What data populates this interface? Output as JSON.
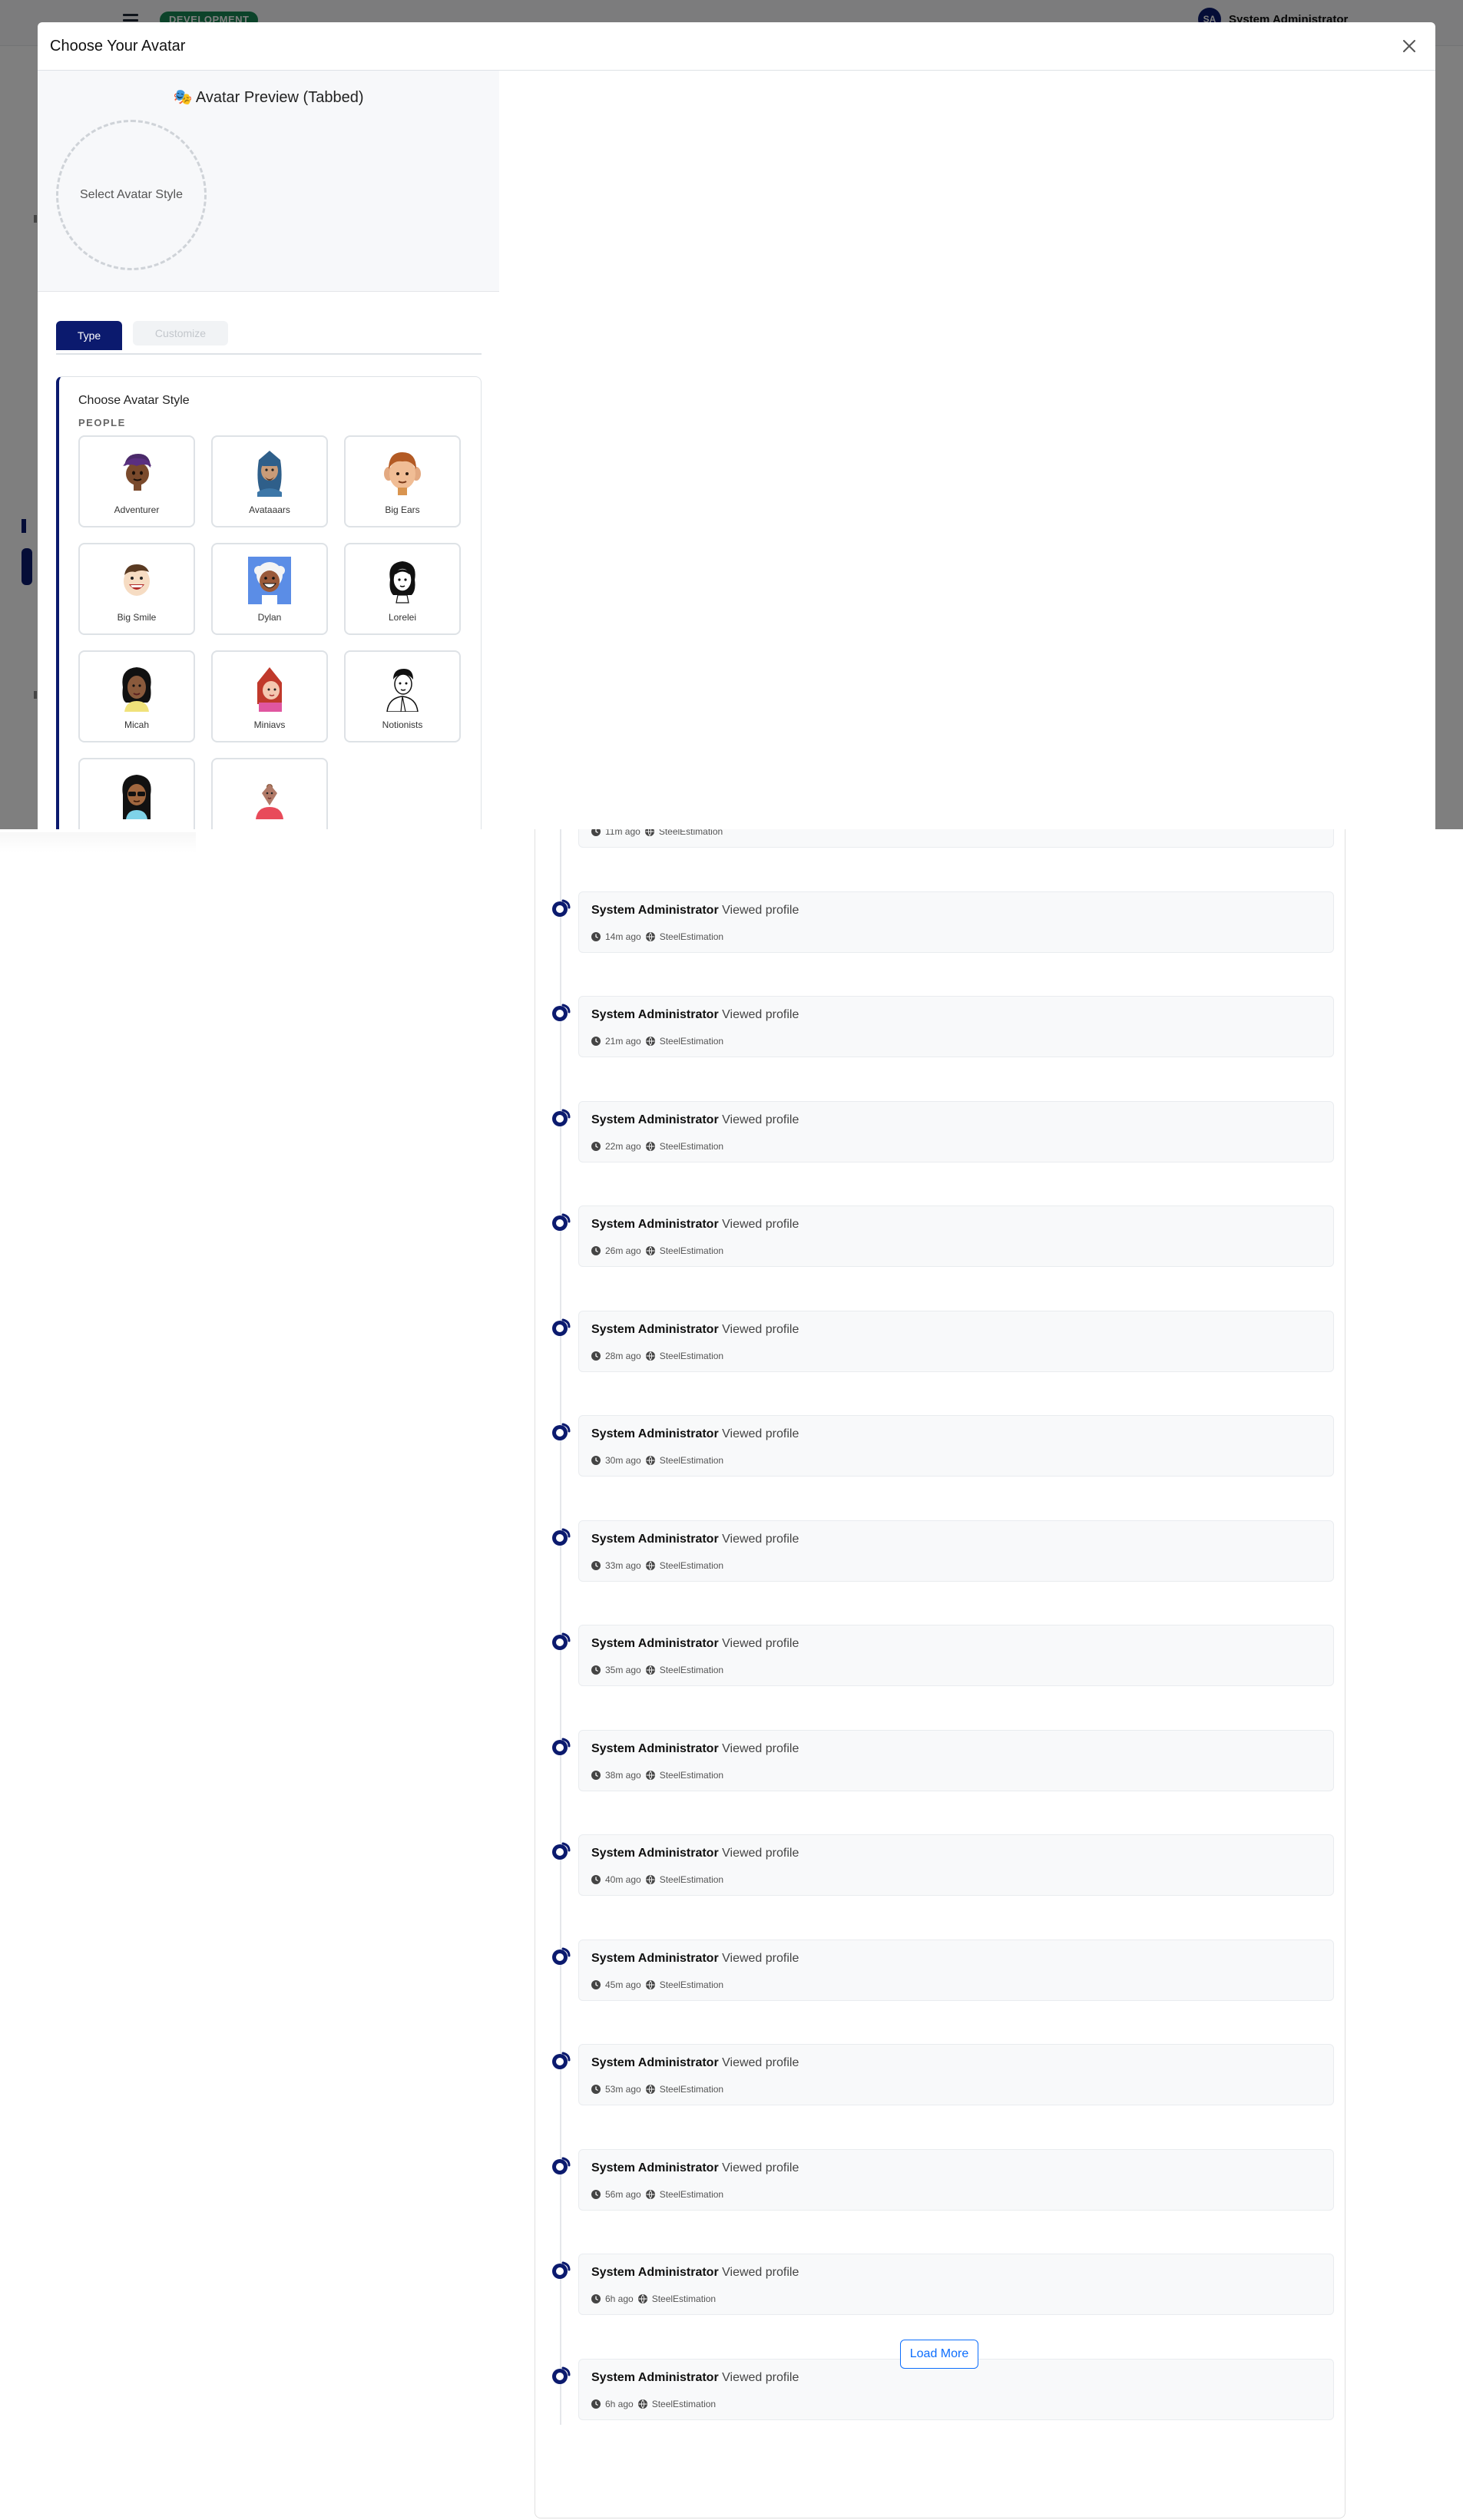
{
  "header": {
    "environment_badge": "DEVELOPMENT",
    "user_initials": "SA",
    "user_name": "System Administrator"
  },
  "modal": {
    "title": "Choose Your Avatar",
    "preview_title": "🎭 Avatar Preview (Tabbed)",
    "preview_placeholder": "Select Avatar Style",
    "tabs": [
      {
        "label": "Type",
        "active": true
      },
      {
        "label": "Customize",
        "active": false
      }
    ],
    "style_section_title": "Choose Avatar Style",
    "group_label": "PEOPLE",
    "styles": [
      {
        "label": "Adventurer",
        "icon": "adventurer-avatar-icon"
      },
      {
        "label": "Avataaars",
        "icon": "avataaars-avatar-icon"
      },
      {
        "label": "Big Ears",
        "icon": "big-ears-avatar-icon"
      },
      {
        "label": "Big Smile",
        "icon": "big-smile-avatar-icon"
      },
      {
        "label": "Dylan",
        "icon": "dylan-avatar-icon"
      },
      {
        "label": "Lorelei",
        "icon": "lorelei-avatar-icon"
      },
      {
        "label": "Micah",
        "icon": "micah-avatar-icon"
      },
      {
        "label": "Miniavs",
        "icon": "miniavs-avatar-icon"
      },
      {
        "label": "Notionists",
        "icon": "notionists-avatar-icon"
      },
      {
        "label": "",
        "icon": "open-peeps-avatar-icon"
      },
      {
        "label": "",
        "icon": "personas-avatar-icon"
      }
    ]
  },
  "activity": {
    "items": [
      {
        "actor": "System Administrator",
        "action": "Viewed profile",
        "time": "11m ago",
        "app": "SteelEstimation"
      },
      {
        "actor": "System Administrator",
        "action": "Viewed profile",
        "time": "14m ago",
        "app": "SteelEstimation"
      },
      {
        "actor": "System Administrator",
        "action": "Viewed profile",
        "time": "21m ago",
        "app": "SteelEstimation"
      },
      {
        "actor": "System Administrator",
        "action": "Viewed profile",
        "time": "22m ago",
        "app": "SteelEstimation"
      },
      {
        "actor": "System Administrator",
        "action": "Viewed profile",
        "time": "26m ago",
        "app": "SteelEstimation"
      },
      {
        "actor": "System Administrator",
        "action": "Viewed profile",
        "time": "28m ago",
        "app": "SteelEstimation"
      },
      {
        "actor": "System Administrator",
        "action": "Viewed profile",
        "time": "30m ago",
        "app": "SteelEstimation"
      },
      {
        "actor": "System Administrator",
        "action": "Viewed profile",
        "time": "33m ago",
        "app": "SteelEstimation"
      },
      {
        "actor": "System Administrator",
        "action": "Viewed profile",
        "time": "35m ago",
        "app": "SteelEstimation"
      },
      {
        "actor": "System Administrator",
        "action": "Viewed profile",
        "time": "38m ago",
        "app": "SteelEstimation"
      },
      {
        "actor": "System Administrator",
        "action": "Viewed profile",
        "time": "40m ago",
        "app": "SteelEstimation"
      },
      {
        "actor": "System Administrator",
        "action": "Viewed profile",
        "time": "45m ago",
        "app": "SteelEstimation"
      },
      {
        "actor": "System Administrator",
        "action": "Viewed profile",
        "time": "53m ago",
        "app": "SteelEstimation"
      },
      {
        "actor": "System Administrator",
        "action": "Viewed profile",
        "time": "56m ago",
        "app": "SteelEstimation"
      },
      {
        "actor": "System Administrator",
        "action": "Viewed profile",
        "time": "6h ago",
        "app": "SteelEstimation"
      },
      {
        "actor": "System Administrator",
        "action": "Viewed profile",
        "time": "6h ago",
        "app": "SteelEstimation"
      }
    ],
    "load_more_label": "Load More"
  },
  "colors": {
    "primary": "#0b1a6e",
    "link": "#0d6efd",
    "badge": "#198754"
  }
}
